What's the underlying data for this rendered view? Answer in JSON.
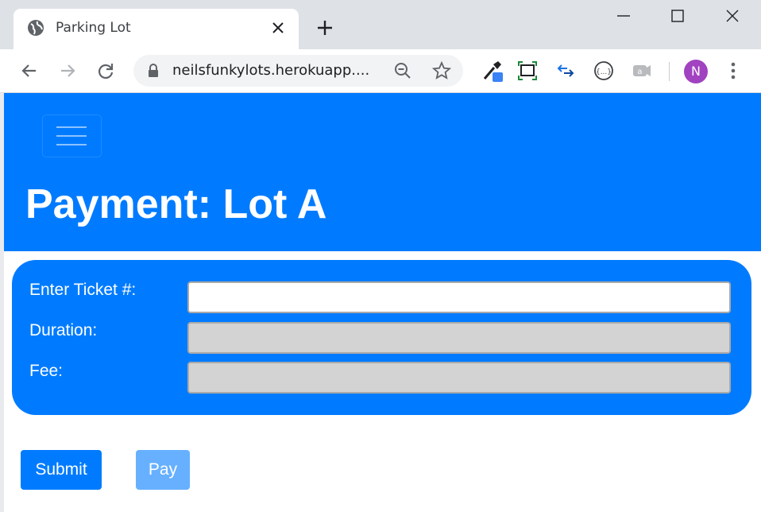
{
  "browser": {
    "tab_title": "Parking Lot",
    "url": "neilsfunkylots.herokuapp....",
    "profile_initial": "N"
  },
  "page": {
    "title": "Payment: Lot A",
    "form": {
      "ticket_label": "Enter Ticket #:",
      "ticket_value": "",
      "duration_label": "Duration:",
      "duration_value": "",
      "fee_label": "Fee:",
      "fee_value": ""
    },
    "submit_label": "Submit",
    "pay_label": "Pay"
  },
  "colors": {
    "primary": "#007bff",
    "pay_disabled": "#66b0ff",
    "disabled_field": "#d3d3d3",
    "avatar": "#a142c0"
  }
}
